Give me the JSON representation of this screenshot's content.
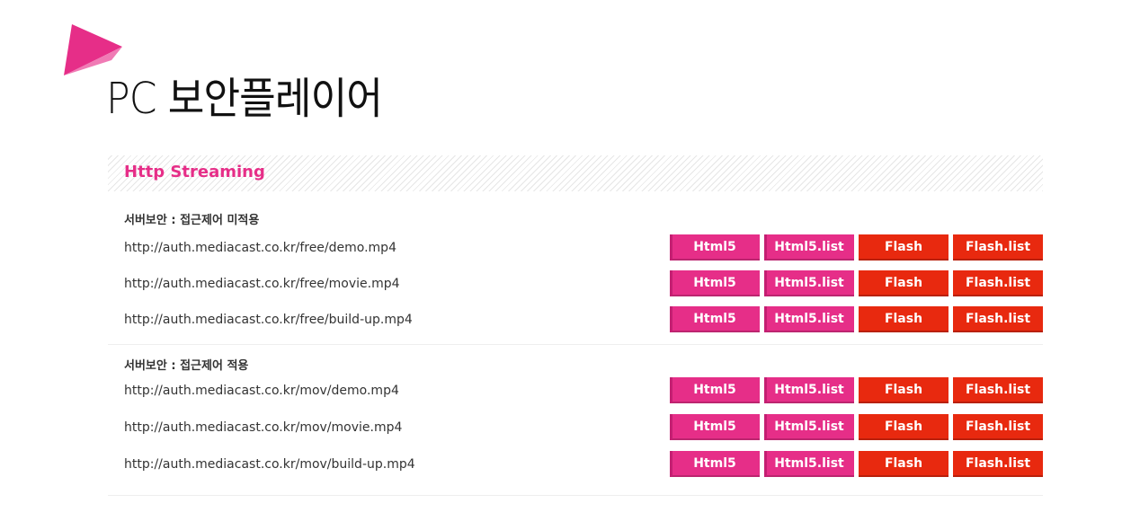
{
  "page": {
    "title": "PC 보안플레이어",
    "brand_color": "#e62e88",
    "accent_red": "#e8290f"
  },
  "section": {
    "title": "Http Streaming"
  },
  "groups": [
    {
      "label": "서버보안 : 접근제어 미적용",
      "rows": [
        {
          "url": "http://auth.mediacast.co.kr/free/demo.mp4",
          "buttons": [
            "Html5",
            "Html5.list",
            "Flash",
            "Flash.list"
          ]
        },
        {
          "url": "http://auth.mediacast.co.kr/free/movie.mp4",
          "buttons": [
            "Html5",
            "Html5.list",
            "Flash",
            "Flash.list"
          ]
        },
        {
          "url": "http://auth.mediacast.co.kr/free/build-up.mp4",
          "buttons": [
            "Html5",
            "Html5.list",
            "Flash",
            "Flash.list"
          ]
        }
      ]
    },
    {
      "label": "서버보안 : 접근제어 적용",
      "rows": [
        {
          "url": "http://auth.mediacast.co.kr/mov/demo.mp4",
          "buttons": [
            "Html5",
            "Html5.list",
            "Flash",
            "Flash.list"
          ]
        },
        {
          "url": "http://auth.mediacast.co.kr/mov/movie.mp4",
          "buttons": [
            "Html5",
            "Html5.list",
            "Flash",
            "Flash.list"
          ]
        },
        {
          "url": "http://auth.mediacast.co.kr/mov/build-up.mp4",
          "buttons": [
            "Html5",
            "Html5.list",
            "Flash",
            "Flash.list"
          ]
        }
      ]
    }
  ]
}
